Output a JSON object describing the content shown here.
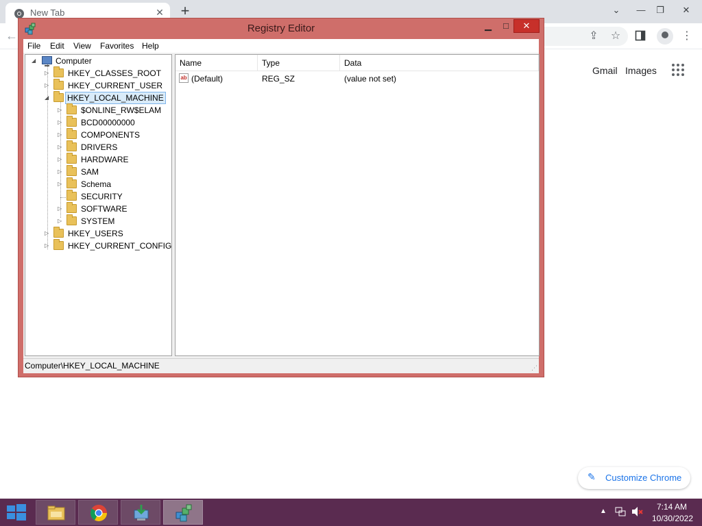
{
  "browser": {
    "tab_title": "New Tab",
    "tab_close": "✕",
    "new_tab": "+",
    "controls": {
      "minimize": "⌄",
      "restore_down": "—",
      "maximize": "❐",
      "close": "✕"
    },
    "toolbar_icons": [
      "share-icon",
      "star-icon",
      "side-panel-icon",
      "profile-icon",
      "kebab-menu-icon"
    ],
    "page": {
      "gmail": "Gmail",
      "images": "Images",
      "customize_chrome": "Customize Chrome"
    }
  },
  "regedit": {
    "title": "Registry Editor",
    "title_controls": {
      "minimize": "▁",
      "maximize": "□",
      "close": "✕"
    },
    "menu": [
      "File",
      "Edit",
      "View",
      "Favorites",
      "Help"
    ],
    "tree": {
      "root": "Computer",
      "hives": [
        "HKEY_CLASSES_ROOT",
        "HKEY_CURRENT_USER",
        "HKEY_LOCAL_MACHINE",
        "HKEY_USERS",
        "HKEY_CURRENT_CONFIG"
      ],
      "selected": "HKEY_LOCAL_MACHINE",
      "hklm_children": [
        "$ONLINE_RW$ELAM",
        "BCD00000000",
        "COMPONENTS",
        "DRIVERS",
        "HARDWARE",
        "SAM",
        "Schema",
        "SECURITY",
        "SOFTWARE",
        "SYSTEM"
      ]
    },
    "list": {
      "columns": [
        "Name",
        "Type",
        "Data"
      ],
      "rows": [
        {
          "name": "(Default)",
          "type": "REG_SZ",
          "data": "(value not set)",
          "icon": "ab"
        }
      ]
    },
    "status": "Computer\\HKEY_LOCAL_MACHINE"
  },
  "taskbar": {
    "apps": [
      "file-explorer-icon",
      "chrome-icon",
      "network-download-icon",
      "regedit-icon"
    ],
    "active_app": "regedit-icon",
    "time": "7:14 AM",
    "date": "10/30/2022"
  },
  "colors": {
    "window_frame": "#cf6e6a",
    "taskbar": "#5a2b50",
    "accent_blue": "#1a73e8",
    "close_red": "#c7302a",
    "selection": "#d9ebf9"
  }
}
